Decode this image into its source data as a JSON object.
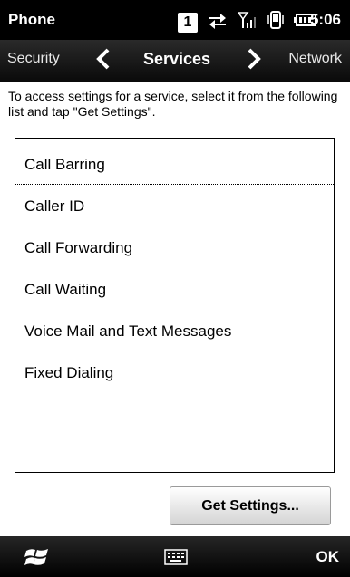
{
  "status_bar": {
    "title": "Phone",
    "sim_number": "1",
    "time": "5:06"
  },
  "nav": {
    "prev_tab": "Security",
    "current_tab": "Services",
    "next_tab": "Network"
  },
  "content": {
    "instruction": "To access settings for a service, select it from the following list and tap \"Get Settings\".",
    "services": [
      "Call Barring",
      "Caller ID",
      "Call Forwarding",
      "Call Waiting",
      "Voice Mail and Text Messages",
      "Fixed Dialing"
    ],
    "selected_index": 0,
    "get_settings_label": "Get Settings..."
  },
  "softkeys": {
    "right_label": "OK"
  }
}
